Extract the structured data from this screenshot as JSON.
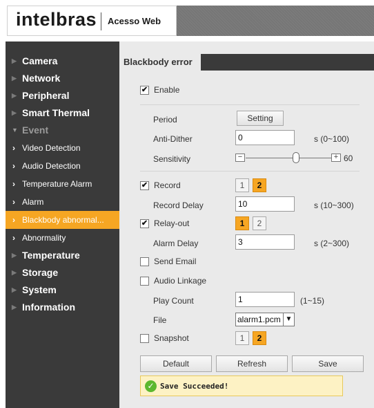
{
  "header": {
    "brand": "intelbras",
    "product": "Acesso Web"
  },
  "sidebar": {
    "items": [
      {
        "label": "Camera"
      },
      {
        "label": "Network"
      },
      {
        "label": "Peripheral"
      },
      {
        "label": "Smart Thermal"
      },
      {
        "label": "Event",
        "expanded": true
      },
      {
        "label": "Temperature"
      },
      {
        "label": "Storage"
      },
      {
        "label": "System"
      },
      {
        "label": "Information"
      }
    ],
    "event_children": [
      {
        "label": "Video Detection"
      },
      {
        "label": "Audio Detection"
      },
      {
        "label": "Temperature Alarm"
      },
      {
        "label": "Alarm"
      },
      {
        "label": "Blackbody abnormal...",
        "active": true
      },
      {
        "label": "Abnormality"
      }
    ]
  },
  "main": {
    "tab": "Blackbody error",
    "enable_label": "Enable",
    "enable_checked": true,
    "period_label": "Period",
    "period_button": "Setting",
    "antidither_label": "Anti-Dither",
    "antidither_value": "0",
    "antidither_unit": "s (0~100)",
    "sensitivity_label": "Sensitivity",
    "sensitivity_minus": "−",
    "sensitivity_plus": "+",
    "sensitivity_value": "60",
    "record_label": "Record",
    "record_checked": true,
    "record_channels": [
      "1",
      "2"
    ],
    "record_selected": [
      "2"
    ],
    "record_delay_label": "Record Delay",
    "record_delay_value": "10",
    "record_delay_unit": "s (10~300)",
    "relay_label": "Relay-out",
    "relay_checked": true,
    "relay_channels": [
      "1",
      "2"
    ],
    "relay_selected": [
      "1"
    ],
    "alarm_delay_label": "Alarm Delay",
    "alarm_delay_value": "3",
    "alarm_delay_unit": "s (2~300)",
    "send_email_label": "Send Email",
    "audio_linkage_label": "Audio Linkage",
    "play_count_label": "Play Count",
    "play_count_value": "1",
    "play_count_unit": "(1~15)",
    "file_label": "File",
    "file_value": "alarm1.pcm",
    "snapshot_label": "Snapshot",
    "snapshot_channels": [
      "1",
      "2"
    ],
    "snapshot_selected": [
      "2"
    ],
    "buttons": {
      "default": "Default",
      "refresh": "Refresh",
      "save": "Save"
    },
    "status_text": "Save Succeeded!"
  },
  "colors": {
    "accent": "#f6a623",
    "sidebar_bg": "#3a3a3a",
    "content_bg": "#eaeaea",
    "success": "#5cb82e"
  }
}
